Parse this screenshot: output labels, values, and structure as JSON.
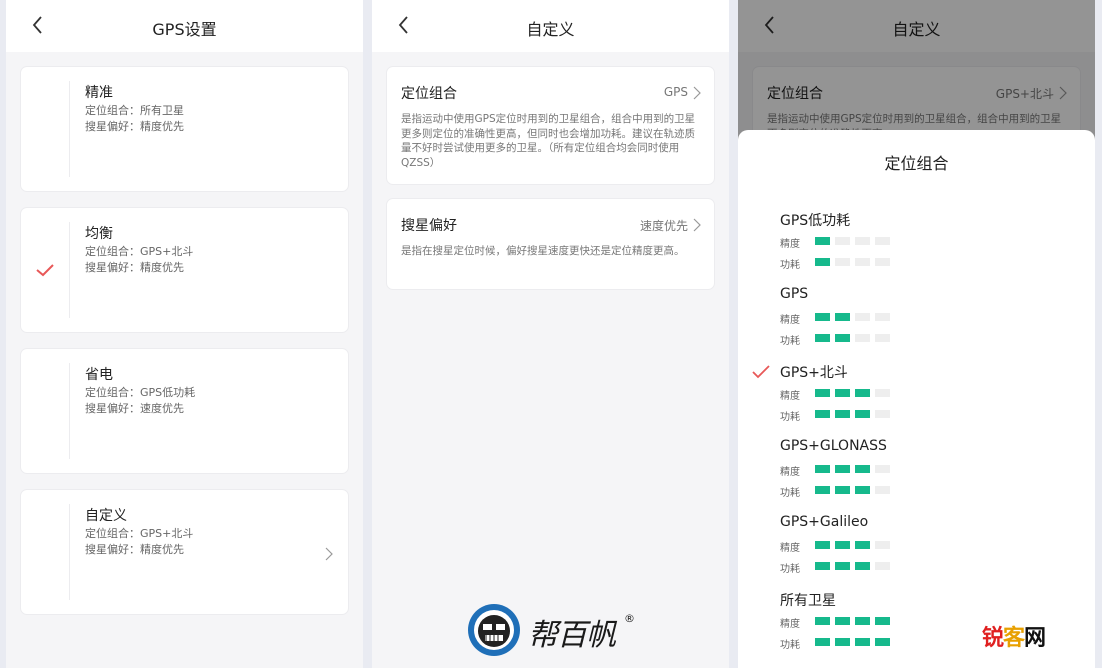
{
  "panel1": {
    "title": "GPS设置",
    "modes": [
      {
        "name": "精准",
        "l1": "定位组合：所有卫星",
        "l2": "搜星偏好：精度优先",
        "checked": false,
        "arrow": false
      },
      {
        "name": "均衡",
        "l1": "定位组合：GPS+北斗",
        "l2": "搜星偏好：精度优先",
        "checked": true,
        "arrow": false
      },
      {
        "name": "省电",
        "l1": "定位组合：GPS低功耗",
        "l2": "搜星偏好：速度优先",
        "checked": false,
        "arrow": false
      },
      {
        "name": "自定义",
        "l1": "定位组合：GPS+北斗",
        "l2": "搜星偏好：精度优先",
        "checked": false,
        "arrow": true
      }
    ]
  },
  "panel2": {
    "title": "自定义",
    "combo": {
      "name": "定位组合",
      "value": "GPS",
      "desc": "是指运动中使用GPS定位时用到的卫星组合，组合中用到的卫星更多则定位的准确性更高，但同时也会增加功耗。建议在轨迹质量不好时尝试使用更多的卫星。（所有定位组合均会同时使用QZSS）"
    },
    "pref": {
      "name": "搜星偏好",
      "value": "速度优先",
      "desc": "是指在搜星定位时候，偏好搜星速度更快还是定位精度更高。"
    }
  },
  "panel3": {
    "title": "自定义",
    "combo_name": "定位组合",
    "combo_value": "GPS+北斗",
    "combo_desc": "是指运动中使用GPS定位时用到的卫星组合，组合中用到的卫星更多则定位的准确性更高",
    "sheet_title": "定位组合",
    "accuracy_label": "精度",
    "power_label": "功耗",
    "bar_max": 4,
    "bar_color": "#16b98c",
    "options": [
      {
        "name": "GPS低功耗",
        "accuracy": 1,
        "power": 1,
        "checked": false
      },
      {
        "name": "GPS",
        "accuracy": 2,
        "power": 2,
        "checked": false
      },
      {
        "name": "GPS+北斗",
        "accuracy": 3,
        "power": 3,
        "checked": true
      },
      {
        "name": "GPS+GLONASS",
        "accuracy": 3,
        "power": 3,
        "checked": false
      },
      {
        "name": "GPS+Galileo",
        "accuracy": 3,
        "power": 3,
        "checked": false
      },
      {
        "name": "所有卫星",
        "accuracy": 4,
        "power": 4,
        "checked": false
      }
    ]
  },
  "watermark_left": "帮百帆",
  "watermark_left_mark": "®",
  "watermark_right": [
    "锐",
    "客",
    "网"
  ],
  "check_color": "#e85858"
}
